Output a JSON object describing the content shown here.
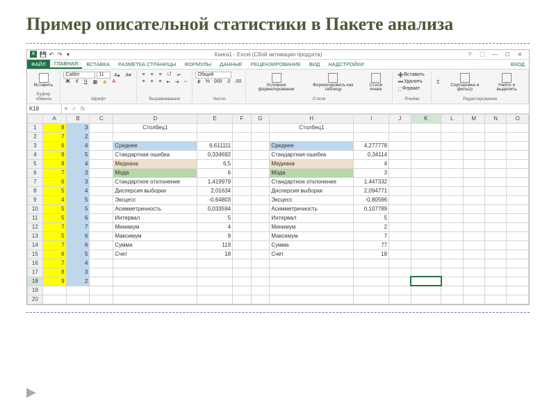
{
  "slide": {
    "title": "Пример описательной статистики в Пакете анализа"
  },
  "titlebar": {
    "title": "Книга1 - Excel (Сбой активации продукта)",
    "login": "Вход"
  },
  "tabs": {
    "file": "ФАЙЛ",
    "home": "ГЛАВНАЯ",
    "insert": "ВСТАВКА",
    "layout": "РАЗМЕТКА СТРАНИЦЫ",
    "formulas": "ФОРМУЛЫ",
    "data": "ДАННЫЕ",
    "review": "РЕЦЕНЗИРОВАНИЕ",
    "view": "ВИД",
    "addins": "НАДСТРОЙКИ"
  },
  "ribbon": {
    "clipboard": {
      "paste": "Вставить",
      "label": "Буфер обмена"
    },
    "font": {
      "name": "Calibri",
      "size": "11",
      "label": "Шрифт"
    },
    "align": {
      "label": "Выравнивание"
    },
    "number": {
      "format": "Общий",
      "label": "Число"
    },
    "styles": {
      "cond": "Условное форматирование",
      "fmt": "Форматировать как таблицу",
      "cell": "Стили ячеек",
      "label": "Стили"
    },
    "cells": {
      "ins": "Вставить",
      "del": "Удалить",
      "fmt": "Формат",
      "label": "Ячейки"
    },
    "edit": {
      "sort": "Сортировка и фильтр",
      "find": "Найти и выделить",
      "label": "Редактирование"
    }
  },
  "namebox": "K18",
  "columns": [
    "A",
    "B",
    "C",
    "D",
    "E",
    "F",
    "G",
    "H",
    "I",
    "J",
    "K",
    "L",
    "M",
    "N",
    "O"
  ],
  "rowsA": [
    8,
    7,
    6,
    9,
    8,
    7,
    6,
    5,
    4,
    5,
    5,
    7,
    5,
    7,
    6,
    7,
    8,
    9
  ],
  "rowsB": [
    3,
    2,
    4,
    5,
    4,
    3,
    3,
    4,
    5,
    5,
    6,
    7,
    6,
    6,
    5,
    4,
    3,
    2
  ],
  "stats": {
    "header": "Столбец1",
    "labels": {
      "mean": "Среднее",
      "stderr": "Стандартная ошибка",
      "median": "Медиана",
      "mode": "Мода",
      "stdev": "Стандартное отклонение",
      "var": "Дисперсия выборки",
      "kurt": "Эксцесс",
      "skew": "Асимметричность",
      "range": "Интервал",
      "min": "Минимум",
      "max": "Максимум",
      "sum": "Сумма",
      "count": "Счет"
    },
    "col1": {
      "mean": "6,611111",
      "stderr": "0,334692",
      "median": "6,5",
      "mode": "6",
      "stdev": "1,419979",
      "var": "2,01634",
      "kurt": "-0,64803",
      "skew": "0,033594",
      "range": "5",
      "min": "4",
      "max": "9",
      "sum": "119",
      "count": "18"
    },
    "col2": {
      "mean": "4,277778",
      "stderr": "0,34114",
      "median": "4",
      "mode": "3",
      "stdev": "1,447332",
      "var": "2,094771",
      "kurt": "-0,80596",
      "skew": "0,107789",
      "range": "5",
      "min": "2",
      "max": "7",
      "sum": "77",
      "count": "18"
    }
  }
}
